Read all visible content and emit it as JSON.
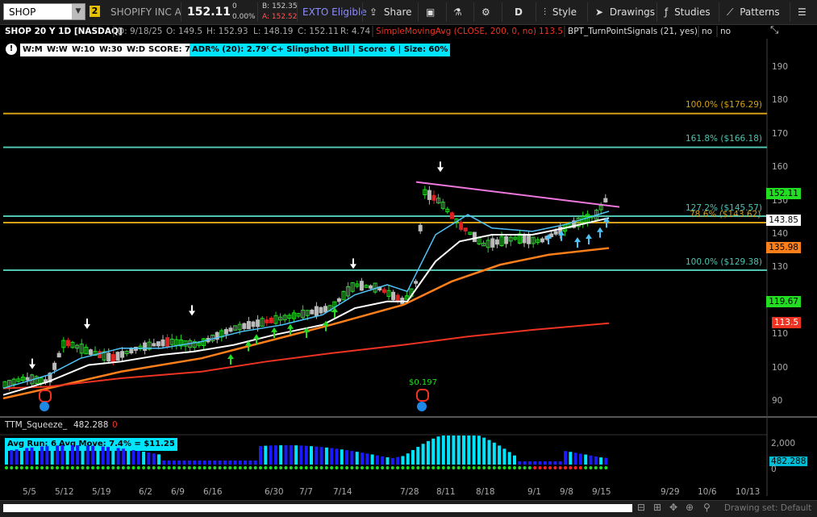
{
  "toolbar": {
    "symbol": "SHOP",
    "link_group": "2",
    "company": "SHOPIFY INC A",
    "last_price": "152.11",
    "change": "0",
    "change_pct": "0.00%",
    "bid": "B: 152.35",
    "ask": "A: 152.52",
    "exto": "EXTO Eligible",
    "share": "Share",
    "period": "D",
    "style": "Style",
    "drawings": "Drawings",
    "studies": "Studies",
    "patterns": "Patterns"
  },
  "header": {
    "title": "SHOP 20 Y 1D [NASDAQ]",
    "date": "D: 9/18/25",
    "open": "O: 149.5",
    "high": "H: 152.93",
    "low": "L: 148.19",
    "close": "C: 152.11",
    "range": "R: 4.74",
    "sma_label": "SimpleMovingAvg (CLOSE, 200, 0, no)",
    "sma_value": "113.5",
    "bpt_label": "BPT_TurnPointSignals (21, yes)",
    "bpt_v1": "no",
    "bpt_v2": "no"
  },
  "chips": {
    "info": "!",
    "wm": "W:M",
    "ww": "W:W",
    "w10": "W:10",
    "w30": "W:30",
    "wd": "W:D",
    "score": "SCORE: 7",
    "adr": "ADR% (20): 2.79%",
    "slingshot": "C+ Slingshot Bull | Score: 6 | Size: 60%"
  },
  "price_axis": [
    "190",
    "180",
    "170",
    "160",
    "150",
    "140",
    "130",
    "120",
    "110",
    "100",
    "90"
  ],
  "price_boxes": {
    "last": "152.11",
    "bid_line": "143.85",
    "ema_fast": "135.98",
    "ema_mid": "119.67",
    "sma200": "113.5"
  },
  "fib_levels": {
    "f100_top": "100.0%  ($176.29)",
    "f161": "161.8%  ($166.18)",
    "f127": "127.2%  ($145.57)",
    "f78": "78.6%  ($143.62)",
    "f100_low": "100.0%  ($129.38)"
  },
  "dividend": "$0.197",
  "indicator": {
    "name": "TTM_Squeeze_",
    "value": "482.288",
    "value2": "0",
    "avg_run": "Avg Run: 6",
    "avg_move": "Avg Move: 7.4% = $11.25",
    "axis_top": "2,000",
    "axis_value": "482.288",
    "axis_zero": "0"
  },
  "dates": [
    "5/5",
    "5/12",
    "5/19",
    "6/2",
    "6/9",
    "6/16",
    "6/30",
    "7/7",
    "7/14",
    "7/28",
    "8/11",
    "8/18",
    "9/1",
    "9/8",
    "9/15",
    "9/29",
    "10/6",
    "10/13"
  ],
  "footer": {
    "drawing_set": "Drawing set: Default"
  },
  "colors": {
    "bull": "#22dd22",
    "bear": "#dd2222",
    "fib_gold": "#d4a017",
    "fib_teal": "#4fc3b0",
    "ema_orange": "#ff7f1a",
    "sma_red": "#ee3322",
    "trend_pink": "#ee77dd",
    "chip_cyan": "#00e5ff"
  }
}
